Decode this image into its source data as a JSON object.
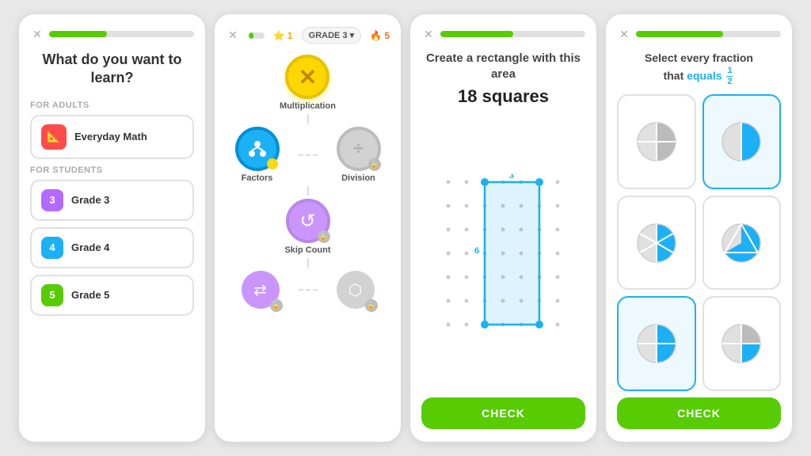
{
  "card1": {
    "closeIcon": "✕",
    "progressFill": "40%",
    "title": "What do you want to learn?",
    "adultsLabel": "For Adults",
    "adultsOption": {
      "icon": "📐",
      "iconBg": "#ff4b4b",
      "label": "Everyday Math"
    },
    "studentsLabel": "For Students",
    "studentOptions": [
      {
        "grade": "3",
        "color": "#b469ff",
        "label": "Grade 3"
      },
      {
        "grade": "4",
        "color": "#1cb0f6",
        "label": "Grade 4"
      },
      {
        "grade": "5",
        "color": "#58cc02",
        "label": "Grade 5"
      }
    ]
  },
  "card2": {
    "closeIcon": "✕",
    "progressFill": "30%",
    "starCount": "1",
    "gradeLabel": "GRADE 3",
    "flameCount": "5",
    "skills": [
      {
        "id": "multiplication",
        "label": "Multiplication",
        "type": "active-gold",
        "icon": "✕",
        "locked": false
      },
      {
        "id": "factors",
        "label": "Factors",
        "type": "active-blue",
        "icon": "⬡",
        "locked": false
      },
      {
        "id": "division",
        "label": "Division",
        "type": "locked",
        "icon": "÷",
        "locked": true
      },
      {
        "id": "skipcount",
        "label": "Skip Count",
        "type": "locked-purple",
        "icon": "↺",
        "locked": true
      },
      {
        "id": "row3a",
        "label": "",
        "type": "active-purple-sm",
        "icon": "⇄",
        "locked": true
      },
      {
        "id": "row3b",
        "label": "",
        "type": "locked-sm",
        "icon": "⬡",
        "locked": true
      }
    ]
  },
  "card3": {
    "closeIcon": "✕",
    "progressFill": "50%",
    "title": "Create a rectangle with this area",
    "area": "18 squares",
    "dimensionW": "3",
    "dimensionH": "6",
    "checkLabel": "CHECK",
    "gridCols": 7,
    "gridRows": 7
  },
  "card4": {
    "closeIcon": "✕",
    "progressFill": "60%",
    "titlePart1": "Select every fraction",
    "titlePart2": "that",
    "titleEquals": "equals",
    "titleFraction": "1/2",
    "checkLabel": "CHECK",
    "pies": [
      {
        "id": "pie1",
        "selected": false,
        "type": "half-gray"
      },
      {
        "id": "pie2",
        "selected": true,
        "type": "half-blue"
      },
      {
        "id": "pie3",
        "selected": false,
        "type": "sixth-blue"
      },
      {
        "id": "pie4",
        "selected": false,
        "type": "third-blue"
      },
      {
        "id": "pie5",
        "selected": true,
        "type": "quarter-blue"
      },
      {
        "id": "pie6",
        "selected": false,
        "type": "quarter-gray"
      }
    ]
  }
}
